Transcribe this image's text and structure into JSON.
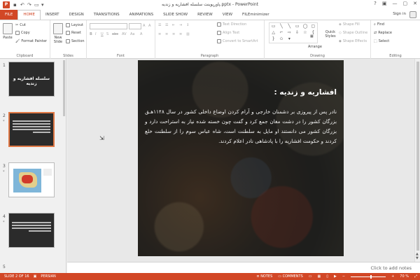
{
  "window": {
    "title": "پاورپوینت سلسله افشاریه و زندیه.pptx - PowerPoint",
    "app_icon": "P"
  },
  "tabs": [
    "FILE",
    "HOME",
    "INSERT",
    "DESIGN",
    "TRANSITIONS",
    "ANIMATIONS",
    "SLIDE SHOW",
    "REVIEW",
    "VIEW",
    "FILEminimizer"
  ],
  "signin": "Sign in",
  "ribbon": {
    "clipboard": {
      "paste": "Paste",
      "cut": "Cut",
      "copy": "Copy",
      "format_painter": "Format Painter",
      "label": "Clipboard"
    },
    "slides": {
      "new_slide": "New Slide",
      "layout": "Layout",
      "reset": "Reset",
      "section": "Section",
      "label": "Slides"
    },
    "font": {
      "label": "Font"
    },
    "paragraph": {
      "text_direction": "Text Direction",
      "align_text": "Align Text",
      "convert_smartart": "Convert to SmartArt",
      "label": "Paragraph"
    },
    "drawing": {
      "arrange": "Arrange",
      "quick_styles": "Quick Styles",
      "shape_fill": "Shape Fill",
      "shape_outline": "Shape Outline",
      "shape_effects": "Shape Effects",
      "label": "Drawing"
    },
    "editing": {
      "find": "Find",
      "replace": "Replace",
      "select": "Select",
      "label": "Editing"
    }
  },
  "thumbnails": [
    {
      "num": "1",
      "title": "سلسله افشاریه و زندیه"
    },
    {
      "num": "2",
      "star": "*"
    },
    {
      "num": "3",
      "star": "*"
    },
    {
      "num": "4",
      "star": "*"
    },
    {
      "num": "5"
    }
  ],
  "slide": {
    "title": "افشاریه و زندیه :",
    "body": "نادر پس از پیروزی بر دشمنان خارجی و آرام کردن اوضاع داخلی کشور در سال ۱۱۴۸هـق بزرگان کشور را در دشت مغان جمع کرد و گفت چون خسته شده نیاز به استراحت دارد و بزرگان کشور می دانستند او مایل به سلطنت است، شاه عباس سوم را از سلطنت خلع کردند و حکومت افشاریه را با پادشاهی نادر اعلام کردند."
  },
  "notes_placeholder": "Click to add notes",
  "status": {
    "slide": "SLIDE 2 OF 16",
    "language": "PERSIAN",
    "notes": "NOTES",
    "comments": "COMMENTS",
    "zoom": "70 %"
  }
}
